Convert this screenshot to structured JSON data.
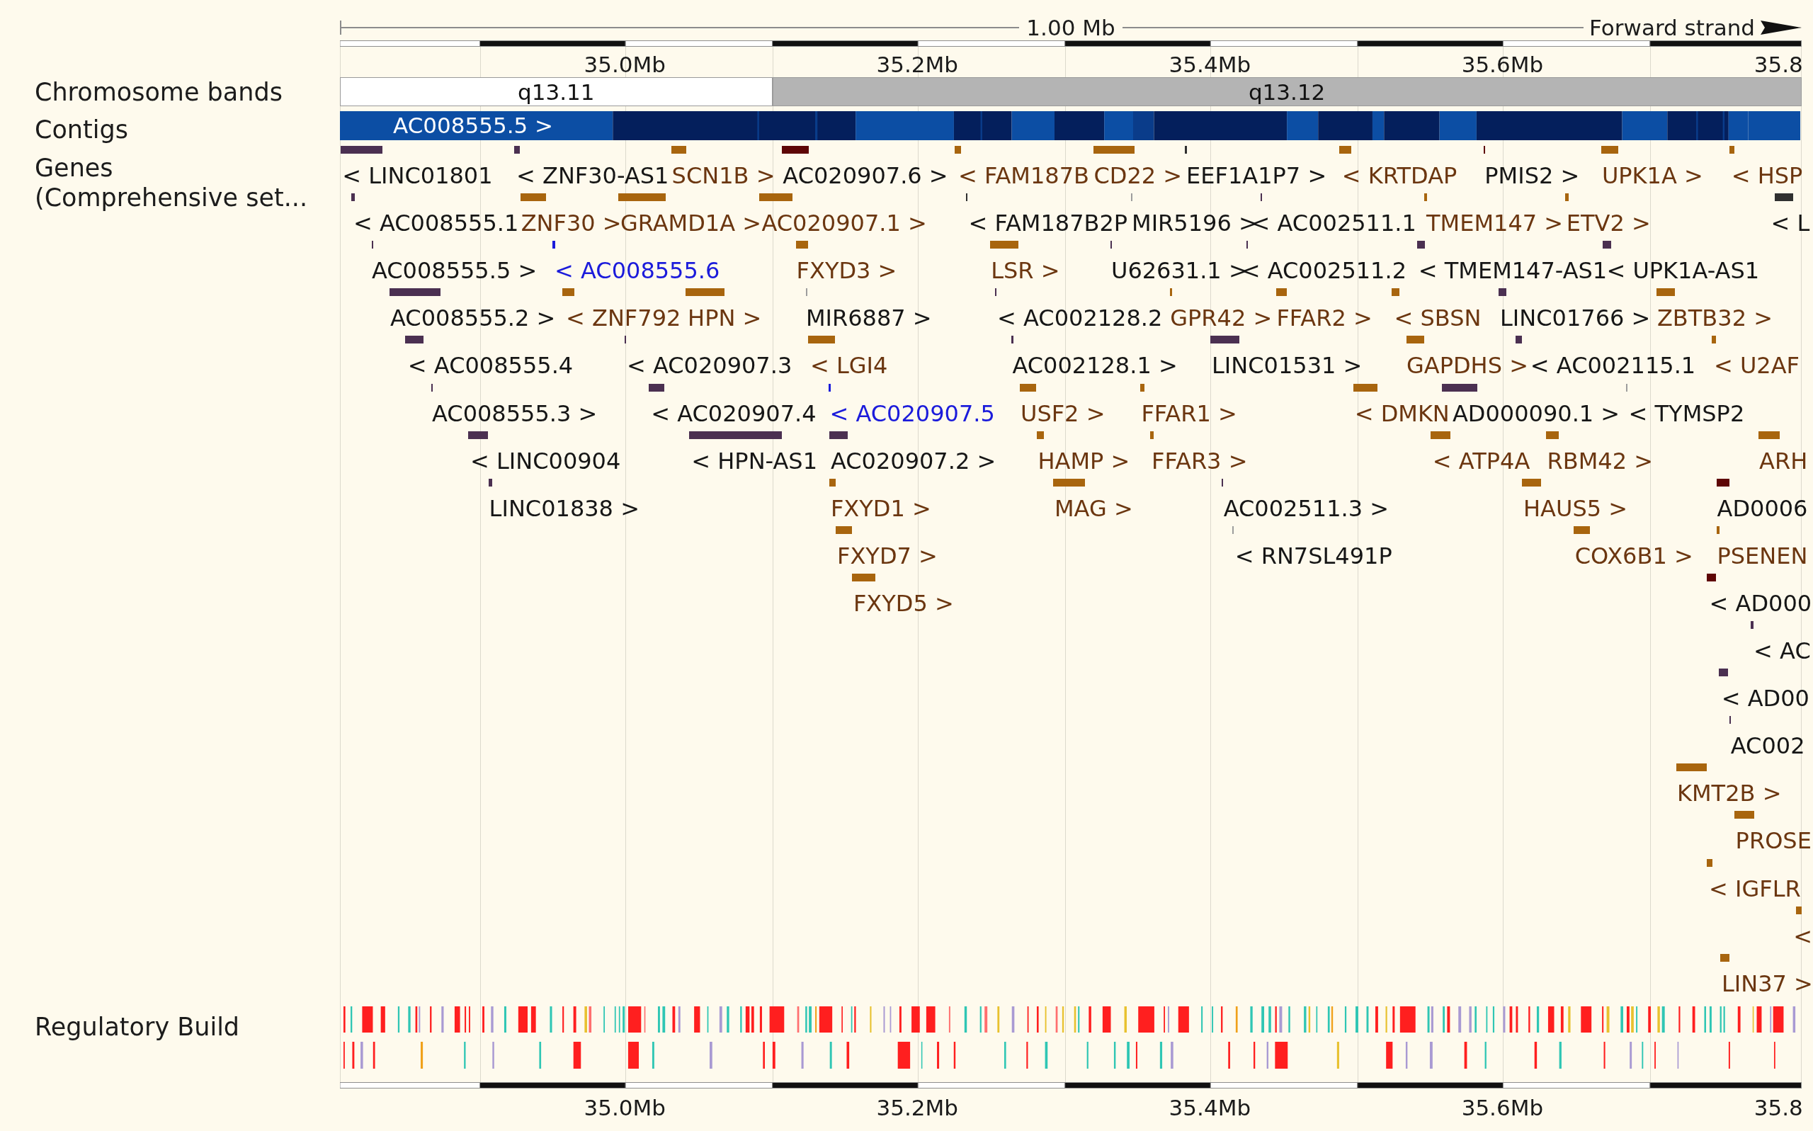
{
  "ruler_top": {
    "length": "1.00 Mb",
    "strand": "Forward strand",
    "ticks": [
      "35.0Mb",
      "35.2Mb",
      "35.4Mb",
      "35.6Mb",
      "35.8"
    ]
  },
  "chromosome_bands": {
    "label": "Chromosome bands",
    "bands": [
      {
        "name": "q13.11",
        "kind": "gneg"
      },
      {
        "name": "q13.12",
        "kind": "gpos"
      }
    ]
  },
  "contigs": {
    "label": "Contigs",
    "contig": "AC008555.5 >"
  },
  "genes": {
    "label": [
      "Genes",
      "(Comprehensive set..."
    ],
    "items": [
      {
        "label": "< LINC01801",
        "kind": "noncoding"
      },
      {
        "label": "< ZNF30-AS1",
        "kind": "noncoding"
      },
      {
        "label": "SCN1B >",
        "kind": "coding"
      },
      {
        "label": "AC020907.6 >",
        "kind": "other"
      },
      {
        "label": "< FAM187B",
        "kind": "coding"
      },
      {
        "label": "CD22 >",
        "kind": "coding"
      },
      {
        "label": "EEF1A1P7 >",
        "kind": "pseudogene"
      },
      {
        "label": "< KRTDAP",
        "kind": "coding"
      },
      {
        "label": "PMIS2 >",
        "kind": "other"
      },
      {
        "label": "UPK1A >",
        "kind": "coding"
      },
      {
        "label": "< HSP",
        "kind": "coding"
      },
      {
        "label": "< AC008555.1",
        "kind": "noncoding"
      },
      {
        "label": "ZNF30 >",
        "kind": "coding"
      },
      {
        "label": "GRAMD1A >",
        "kind": "coding"
      },
      {
        "label": "AC020907.1 >",
        "kind": "coding"
      },
      {
        "label": "< FAM187B2P",
        "kind": "pseudogene"
      },
      {
        "label": "MIR5196 >",
        "kind": "processed"
      },
      {
        "label": "< AC002511.1",
        "kind": "noncoding"
      },
      {
        "label": "TMEM147 >",
        "kind": "coding"
      },
      {
        "label": "ETV2 >",
        "kind": "coding"
      },
      {
        "label": "< L",
        "kind": "pseudogene"
      },
      {
        "label": "AC008555.5 >",
        "kind": "noncoding"
      },
      {
        "label": "< AC008555.6",
        "kind": "rna"
      },
      {
        "label": "FXYD3 >",
        "kind": "coding"
      },
      {
        "label": "LSR >",
        "kind": "coding"
      },
      {
        "label": "U62631.1 >",
        "kind": "noncoding"
      },
      {
        "label": "< AC002511.2",
        "kind": "noncoding"
      },
      {
        "label": "< TMEM147-AS1",
        "kind": "noncoding"
      },
      {
        "label": "< UPK1A-AS1",
        "kind": "noncoding"
      },
      {
        "label": "AC008555.2 >",
        "kind": "noncoding"
      },
      {
        "label": "< ZNF792",
        "kind": "coding"
      },
      {
        "label": "HPN >",
        "kind": "coding"
      },
      {
        "label": "MIR6887 >",
        "kind": "processed"
      },
      {
        "label": "< AC002128.2",
        "kind": "noncoding"
      },
      {
        "label": "GPR42 >",
        "kind": "coding"
      },
      {
        "label": "FFAR2 >",
        "kind": "coding"
      },
      {
        "label": "< SBSN",
        "kind": "coding"
      },
      {
        "label": "LINC01766 >",
        "kind": "noncoding"
      },
      {
        "label": "ZBTB32 >",
        "kind": "coding"
      },
      {
        "label": "< AC008555.4",
        "kind": "noncoding"
      },
      {
        "label": "< AC020907.3",
        "kind": "noncoding"
      },
      {
        "label": "< LGI4",
        "kind": "coding"
      },
      {
        "label": "AC002128.1 >",
        "kind": "noncoding"
      },
      {
        "label": "LINC01531 >",
        "kind": "noncoding"
      },
      {
        "label": "GAPDHS >",
        "kind": "coding"
      },
      {
        "label": "< AC002115.1",
        "kind": "noncoding"
      },
      {
        "label": "< U2AF",
        "kind": "coding"
      },
      {
        "label": "AC008555.3 >",
        "kind": "noncoding"
      },
      {
        "label": "< AC020907.4",
        "kind": "noncoding"
      },
      {
        "label": "< AC020907.5",
        "kind": "rna"
      },
      {
        "label": "USF2 >",
        "kind": "coding"
      },
      {
        "label": "FFAR1 >",
        "kind": "coding"
      },
      {
        "label": "< DMKN",
        "kind": "coding"
      },
      {
        "label": "AD000090.1 >",
        "kind": "noncoding"
      },
      {
        "label": "< TYMSP2",
        "kind": "processed"
      },
      {
        "label": "< LINC00904",
        "kind": "noncoding"
      },
      {
        "label": "< HPN-AS1",
        "kind": "noncoding"
      },
      {
        "label": "AC020907.2 >",
        "kind": "noncoding"
      },
      {
        "label": "HAMP >",
        "kind": "coding"
      },
      {
        "label": "FFAR3 >",
        "kind": "coding"
      },
      {
        "label": "< ATP4A",
        "kind": "coding"
      },
      {
        "label": "RBM42 >",
        "kind": "coding"
      },
      {
        "label": "ARH",
        "kind": "coding"
      },
      {
        "label": "LINC01838 >",
        "kind": "noncoding"
      },
      {
        "label": "FXYD1 >",
        "kind": "coding"
      },
      {
        "label": "MAG >",
        "kind": "coding"
      },
      {
        "label": "AC002511.3 >",
        "kind": "noncoding"
      },
      {
        "label": "HAUS5 >",
        "kind": "coding"
      },
      {
        "label": "AD0006",
        "kind": "other"
      },
      {
        "label": "FXYD7 >",
        "kind": "coding"
      },
      {
        "label": "< RN7SL491P",
        "kind": "processed"
      },
      {
        "label": "COX6B1 >",
        "kind": "coding"
      },
      {
        "label": "PSENEN",
        "kind": "coding"
      },
      {
        "label": "FXYD5 >",
        "kind": "coding"
      },
      {
        "label": "< AD000",
        "kind": "other"
      },
      {
        "label": "< AC",
        "kind": "noncoding"
      },
      {
        "label": "< AD00",
        "kind": "noncoding"
      },
      {
        "label": "AC002",
        "kind": "noncoding"
      },
      {
        "label": "KMT2B >",
        "kind": "coding"
      },
      {
        "label": "PROSE",
        "kind": "coding"
      },
      {
        "label": "< IGFLR",
        "kind": "coding"
      },
      {
        "label": "<",
        "kind": "coding"
      },
      {
        "label": "LIN37 >",
        "kind": "coding"
      }
    ]
  },
  "regulatory_build": {
    "label": "Regulatory Build"
  },
  "ruler_bottom": {
    "ticks": [
      "35.0Mb",
      "35.2Mb",
      "35.4Mb",
      "35.6Mb",
      "35.8"
    ]
  }
}
